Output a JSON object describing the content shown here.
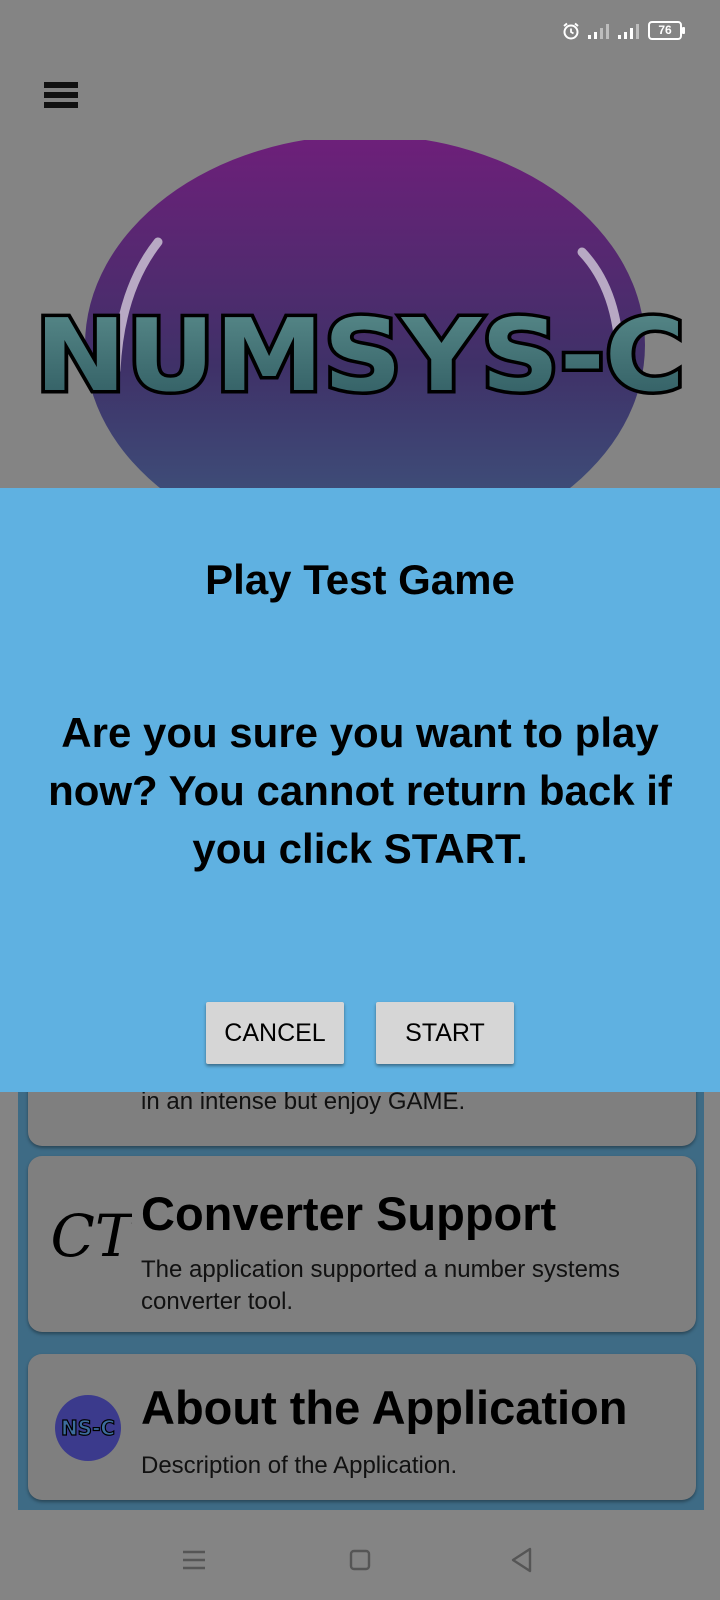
{
  "status_bar": {
    "battery": "76"
  },
  "logo": {
    "text": "NUMSYS-C"
  },
  "dialog": {
    "title": "Play Test Game",
    "message": "Are you sure you want to play now? You cannot return back if you click START.",
    "cancel_label": "CANCEL",
    "start_label": "START"
  },
  "cards": [
    {
      "desc": "in an intense but enjoy GAME."
    },
    {
      "icon_text": "CT",
      "title": "Converter Support",
      "desc": "The application supported a number systems converter tool."
    },
    {
      "icon_text": "NS-C",
      "title": "About the Application",
      "desc": "Description of the Application."
    }
  ],
  "colors": {
    "dialog_bg": "#5fb1e1",
    "scrim": "#848484",
    "card_bg": "#7f7f7f",
    "panel_bg": "#3e6b85"
  }
}
